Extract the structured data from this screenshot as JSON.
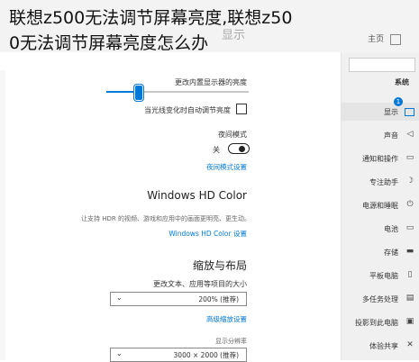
{
  "caption": {
    "line1": "联想z500无法调节屏幕亮度,联想z50",
    "line2": "0无法调节屏幕亮度怎么办"
  },
  "window": {
    "title": "显示",
    "home": "主页"
  },
  "sidebar": {
    "header": "系统",
    "badge": "1",
    "items": [
      {
        "label": "显示",
        "icon": "monitor-icon"
      },
      {
        "label": "声音",
        "icon": "sound-icon"
      },
      {
        "label": "通知和操作",
        "icon": "notification-icon"
      },
      {
        "label": "专注助手",
        "icon": "moon-icon"
      },
      {
        "label": "电源和睡眠",
        "icon": "power-icon"
      },
      {
        "label": "电池",
        "icon": "battery-icon"
      },
      {
        "label": "存储",
        "icon": "storage-icon"
      },
      {
        "label": "平板电脑",
        "icon": "tablet-icon"
      },
      {
        "label": "多任务处理",
        "icon": "multitask-icon"
      },
      {
        "label": "投影到此电脑",
        "icon": "project-icon"
      },
      {
        "label": "体验共享",
        "icon": "share-icon"
      }
    ]
  },
  "main": {
    "brightness_label": "更改内置显示器的亮度",
    "brightness_level": 0.22,
    "auto_brightness_label": "当光线变化时自动调节亮度",
    "night_light_header": "夜间模式",
    "night_light_state": "关",
    "night_light_link": "夜间模式设置",
    "hdr_header": "Windows HD Color",
    "hdr_desc": "让支持 HDR 的视频、游戏和应用中的画面更明亮、更生动。",
    "hdr_link": "Windows HD Color 设置",
    "scale_header": "缩放与布局",
    "scale_label": "更改文本、应用等项目的大小",
    "scale_value": "200% (推荐)",
    "scale_link": "高级缩放设置",
    "resolution_label": "显示分辨率",
    "resolution_value": "3000 × 2000 (推荐)"
  }
}
